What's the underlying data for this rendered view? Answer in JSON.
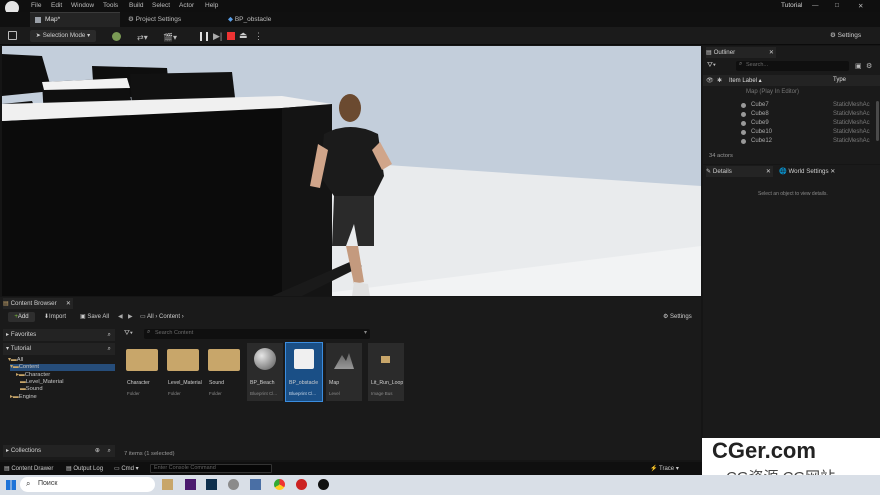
{
  "menu": {
    "items": [
      "File",
      "Edit",
      "Window",
      "Tools",
      "Build",
      "Select",
      "Actor",
      "Help"
    ],
    "project_name": "Tutorial"
  },
  "tabs": {
    "map": "Map*",
    "project_settings": "Project Settings",
    "bp_obstacle": "BP_obstacle"
  },
  "toolbar": {
    "selection_mode": "Selection Mode",
    "settings": "Settings"
  },
  "outliner": {
    "title": "Outliner",
    "search_placeholder": "Search...",
    "col_item_label": "Item Label ▴",
    "col_type": "Type",
    "map_row": "Map (Play In Editor)",
    "rows": [
      {
        "label": "Cube7",
        "type": "StaticMeshAc"
      },
      {
        "label": "Cube8",
        "type": "StaticMeshAc"
      },
      {
        "label": "Cube9",
        "type": "StaticMeshAc"
      },
      {
        "label": "Cube10",
        "type": "StaticMeshAc"
      },
      {
        "label": "Cube12",
        "type": "StaticMeshAc"
      }
    ],
    "actor_count": "34 actors"
  },
  "details": {
    "tab_details": "Details",
    "tab_world": "World Settings",
    "empty_message": "Select an object to view details."
  },
  "content_browser": {
    "title": "Content Browser",
    "add": "Add",
    "import": "Import",
    "save_all": "Save All",
    "breadcrumb_all": "All",
    "breadcrumb_content": "Content",
    "settings": "Settings",
    "favorites": "Favorites",
    "tutorial": "Tutorial",
    "tree": [
      "All",
      "Content",
      "Character",
      "Level_Material",
      "Sound",
      "Engine"
    ],
    "collections": "Collections",
    "search_placeholder": "Search Content",
    "assets": [
      {
        "name": "Character",
        "type": "Folder"
      },
      {
        "name": "Level_Material",
        "type": "Folder"
      },
      {
        "name": "Sound",
        "type": "Folder"
      },
      {
        "name": "BP_Beach",
        "type": "Blueprint Cl..."
      },
      {
        "name": "BP_obstacle",
        "type": "Blueprint Cl..."
      },
      {
        "name": "Map",
        "type": "Level"
      },
      {
        "name": "Lit_Run_Loop",
        "type": "Image Bus"
      }
    ],
    "status": "7 items (1 selected)"
  },
  "statusbar": {
    "content_drawer": "Content Drawer",
    "output_log": "Output Log",
    "cmd": "Cmd",
    "console_placeholder": "Enter Console Command",
    "trace": "Trace"
  },
  "taskbar": {
    "search": "Поиск"
  },
  "watermark": {
    "line1": "CGer.com",
    "line2": "CG资源 CG网站"
  },
  "colors": {
    "accent_blue": "#1473e6",
    "selected_row": "#264d7a",
    "folder": "#c8a66a",
    "viewport_sky": "#c3cedb"
  }
}
